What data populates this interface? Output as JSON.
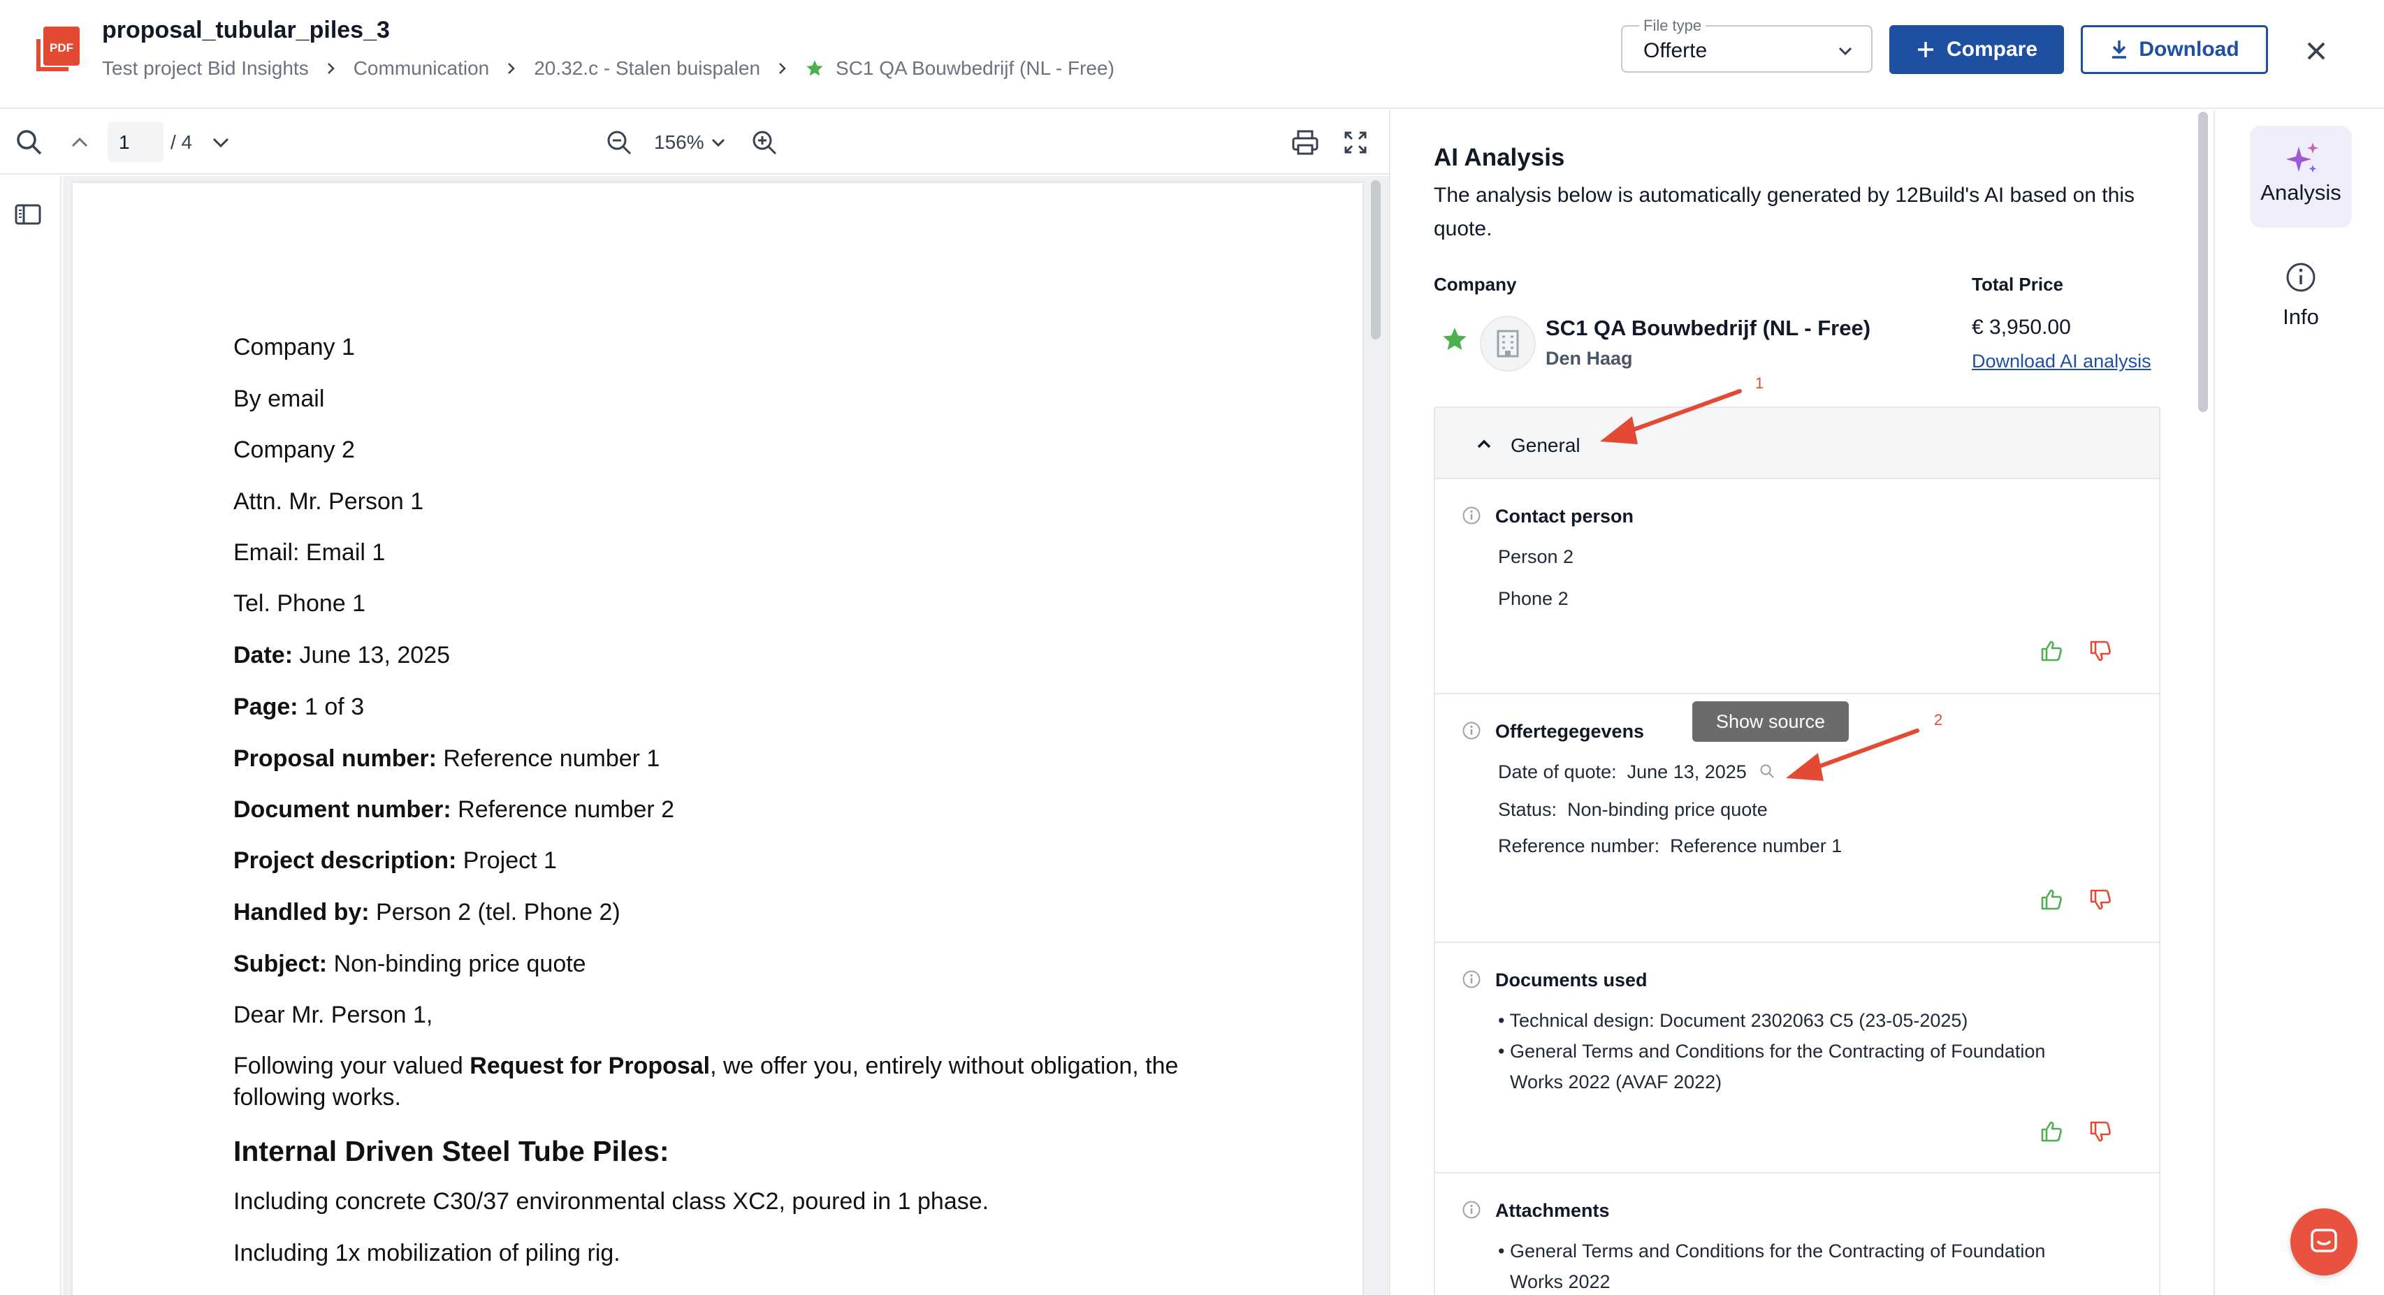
{
  "header": {
    "pdf_badge": "PDF",
    "title": "proposal_tubular_piles_3",
    "breadcrumb": [
      "Test project Bid Insights",
      "Communication",
      "20.32.c - Stalen buispalen",
      "SC1 QA Bouwbedrijf (NL - Free)"
    ],
    "file_type_label": "File type",
    "file_type_value": "Offerte",
    "compare_label": "Compare",
    "download_label": "Download"
  },
  "viewer": {
    "page_current": "1",
    "page_total": "/ 4",
    "zoom": "156%"
  },
  "pdf_lines": [
    {
      "text": "Company 1"
    },
    {
      "text": "By email"
    },
    {
      "text": "Company 2"
    },
    {
      "text": "Attn. Mr. Person 1"
    },
    {
      "text": "Email: Email 1"
    },
    {
      "text": "Tel. Phone 1"
    },
    {
      "bold": "Date:",
      "text": " June 13, 2025"
    },
    {
      "bold": "Page:",
      "text": " 1 of 3"
    },
    {
      "bold": "Proposal number:",
      "text": " Reference number 1"
    },
    {
      "bold": "Document number:",
      "text": " Reference number 2"
    },
    {
      "bold": "Project description:",
      "text": " Project 1"
    },
    {
      "bold": "Handled by:",
      "text": " Person 2 (tel. Phone 2)"
    },
    {
      "bold": "Subject:",
      "text": " Non-binding price quote"
    },
    {
      "text": "Dear Mr. Person 1,"
    },
    {
      "text": "Following your valued ",
      "bold2": "Request for Proposal",
      "text2": ", we offer you, entirely without obligation, the"
    },
    {
      "text": "following works."
    },
    {
      "heading": "Internal Driven Steel Tube Piles:"
    },
    {
      "text": "Including concrete C30/37 environmental class XC2, poured in 1 phase."
    },
    {
      "text": "Including 1x mobilization of piling rig."
    }
  ],
  "analysis": {
    "title": "AI Analysis",
    "description": "The analysis below is automatically generated by 12Build's AI based on this quote.",
    "company_header": "Company",
    "total_header": "Total Price",
    "company_name": "SC1 QA Bouwbedrijf (NL - Free)",
    "company_city": "Den Haag",
    "total_price": "€ 3,950.00",
    "download_ai": "Download AI analysis",
    "general_label": "General",
    "contact": {
      "title": "Contact person",
      "lines": [
        "Person 2",
        "Phone 2"
      ]
    },
    "quote": {
      "title": "Offertegegevens",
      "date_label": "Date of quote:",
      "date_value": "June 13, 2025",
      "status_label": "Status:",
      "status_value": "Non-binding price quote",
      "ref_label": "Reference number:",
      "ref_value": "Reference number 1"
    },
    "docs": {
      "title": "Documents used",
      "lines": [
        "• Technical design: Document 2302063 C5 (23-05-2025)",
        "• General Terms and Conditions for the Contracting of Foundation",
        "Works 2022 (AVAF 2022)"
      ]
    },
    "attachments": {
      "title": "Attachments",
      "lines": [
        "• General Terms and Conditions for the Contracting of Foundation",
        "Works 2022"
      ]
    },
    "tooltip": "Show source"
  },
  "annotations": {
    "arrow1": "1",
    "arrow2": "2"
  },
  "sidebar": {
    "analysis_label": "Analysis",
    "info_label": "Info"
  },
  "colors": {
    "brand": "#1e4fa0",
    "accent_star": "#4caf50",
    "pdf_red": "#e24a33",
    "thumb_up": "#4caf50",
    "thumb_down": "#e24a33"
  }
}
